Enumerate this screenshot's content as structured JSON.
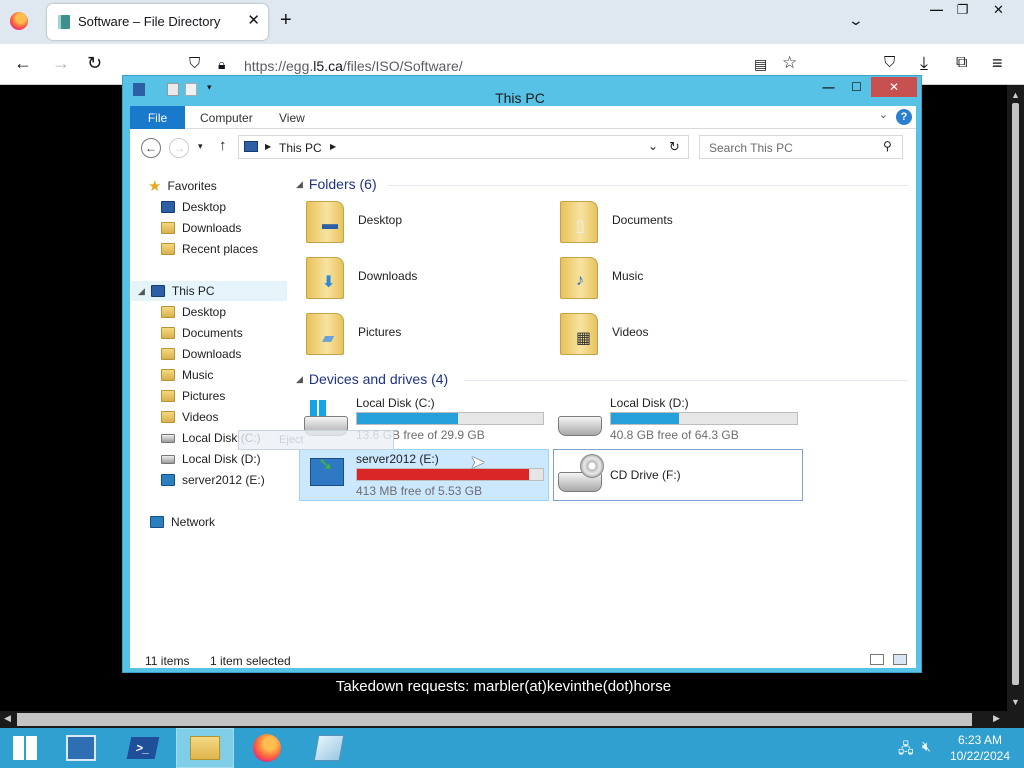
{
  "browser": {
    "tab_title": "Software – File Directory",
    "tab_close": "✕",
    "new_tab": "+",
    "url_host_prefix": "https://egg.",
    "url_host": "l5.ca",
    "url_path": "/files/ISO/Software/",
    "page_footer": "Takedown requests: marbler(at)kevinthe(dot)horse"
  },
  "explorer": {
    "title": "This PC",
    "ribbon": {
      "file": "File",
      "computer": "Computer",
      "view": "View",
      "help": "?"
    },
    "address": "This PC",
    "search_placeholder": "Search This PC",
    "nav": {
      "favorites": "Favorites",
      "fav_items": [
        "Desktop",
        "Downloads",
        "Recent places"
      ],
      "this_pc": "This PC",
      "pc_items": [
        "Desktop",
        "Documents",
        "Downloads",
        "Music",
        "Pictures",
        "Videos",
        "Local Disk (C:)",
        "Local Disk (D:)",
        "server2012 (E:)"
      ],
      "network": "Network"
    },
    "folders_header": "Folders (6)",
    "folders": [
      "Desktop",
      "Documents",
      "Downloads",
      "Music",
      "Pictures",
      "Videos"
    ],
    "drives_header": "Devices and drives (4)",
    "drives": [
      {
        "name": "Local Disk (C:)",
        "free": "13.6 GB free of 29.9 GB",
        "used_fraction": 0.545,
        "bar_color": "#26a0da"
      },
      {
        "name": "Local Disk (D:)",
        "free": "40.8 GB free of 64.3 GB",
        "used_fraction": 0.365,
        "bar_color": "#26a0da"
      },
      {
        "name": "server2012 (E:)",
        "free": "413 MB free of 5.53 GB",
        "used_fraction": 0.925,
        "bar_color": "#da2626"
      },
      {
        "name": "CD Drive (F:)"
      }
    ],
    "tooltip_ghost": "Eject",
    "status_items": "11 items",
    "status_selected": "1 item selected"
  },
  "taskbar": {
    "time": "6:23 AM",
    "date": "10/22/2024"
  }
}
